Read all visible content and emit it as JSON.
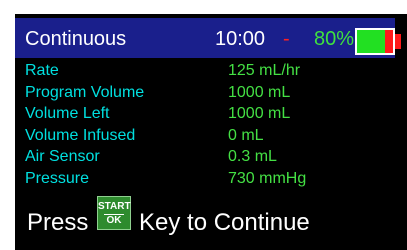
{
  "header": {
    "mode": "Continuous",
    "time": "10:00",
    "alert_marker": "-",
    "battery_percent": "80%",
    "battery_level": 0.8,
    "colors": {
      "bar_bg": "#1a1f8c",
      "battery_text": "#3fe03f",
      "alert": "#ff2020"
    }
  },
  "parameters": [
    {
      "label": "Rate",
      "value": "125 mL/hr"
    },
    {
      "label": "Program Volume",
      "value": "1000 mL"
    },
    {
      "label": "Volume Left",
      "value": "1000 mL"
    },
    {
      "label": "Volume Infused",
      "value": "0 mL"
    },
    {
      "label": "Air Sensor",
      "value": "0.3 mL"
    },
    {
      "label": "Pressure",
      "value": "730 mmHg"
    }
  ],
  "footer": {
    "prefix": "Press",
    "key_top": "START",
    "key_bottom": "OK",
    "suffix": "Key to Continue"
  }
}
